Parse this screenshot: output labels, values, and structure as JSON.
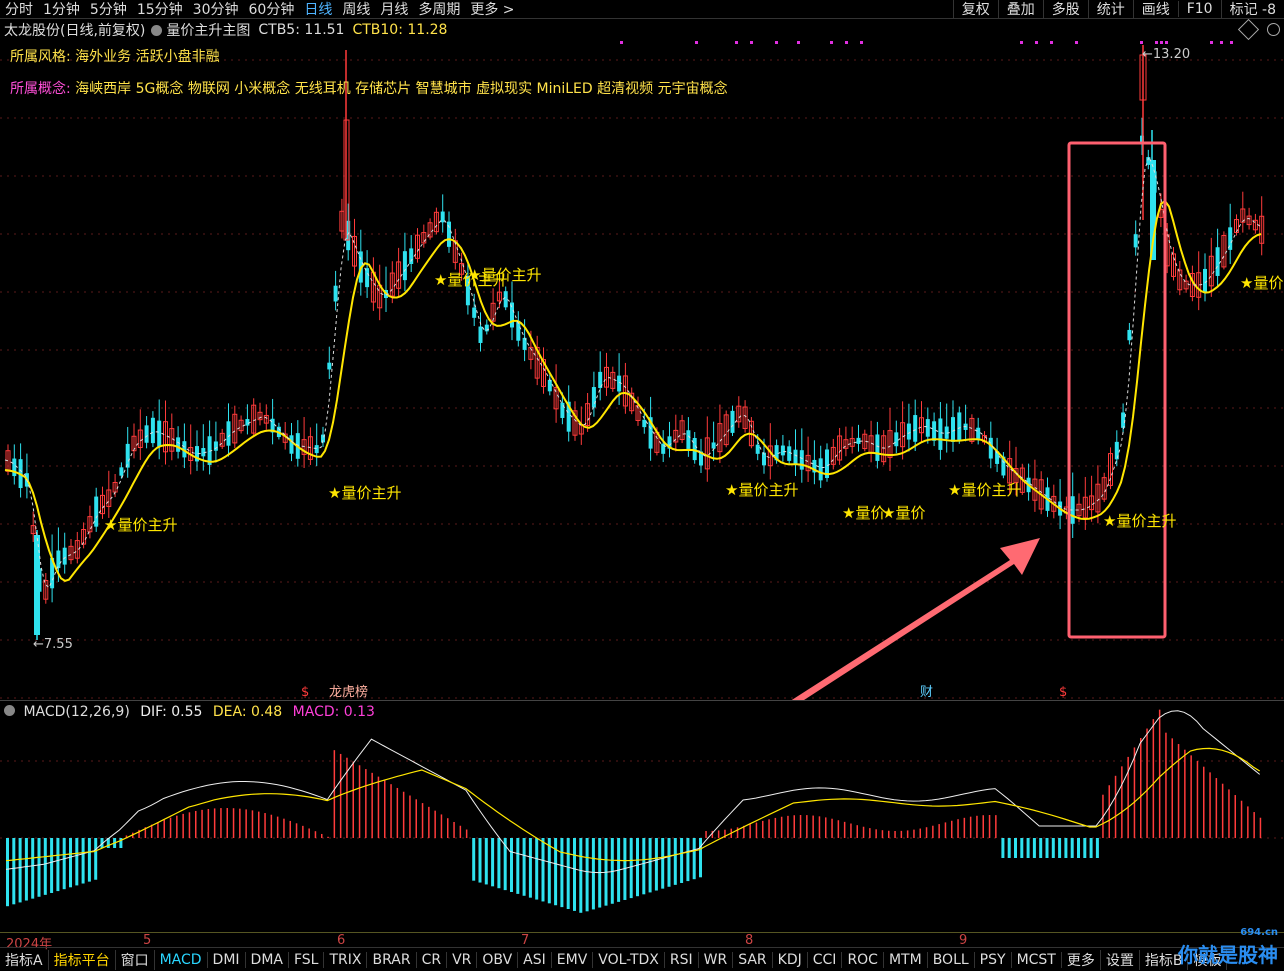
{
  "topbar": {
    "periods": [
      "分时",
      "1分钟",
      "5分钟",
      "15分钟",
      "30分钟",
      "60分钟",
      "日线",
      "周线",
      "月线",
      "多周期",
      "更多 >"
    ],
    "active_index": 6,
    "right_items": [
      "复权",
      "叠加",
      "多股",
      "统计",
      "画线",
      "F10",
      "标记 -8"
    ]
  },
  "titlebar": {
    "stock": "太龙股份(日线,前复权)",
    "indicator": "量价主升主图",
    "ctb5": "CTB5: 11.51",
    "ctb10": "CTB10: 11.28"
  },
  "info": {
    "style_label": "所属风格:",
    "style_value": "海外业务 活跃小盘非融",
    "concept_label": "所属概念:",
    "concept_value": "海峡西岸 5G概念 物联网 小米概念 无线耳机 存储芯片 智慧城市 虚拟现实 MiniLED 超清视频 元宇宙概念"
  },
  "markers": {
    "low": "←7.55",
    "high": "←13.20",
    "signal_label": "★量价主升",
    "signal_cut": "★量价",
    "events": [
      "$",
      "龙虎榜",
      "财",
      "$"
    ]
  },
  "macd": {
    "title": "MACD(12,26,9)",
    "dif": "DIF: 0.55",
    "dea": "DEA: 0.48",
    "macd": "MACD: 0.13"
  },
  "dates": [
    "2024年",
    "5",
    "6",
    "7",
    "8",
    "9"
  ],
  "bottombar": {
    "tabs": [
      "指标A",
      "指标平台",
      "窗口",
      "MACD",
      "DMI",
      "DMA",
      "FSL",
      "TRIX",
      "BRAR",
      "CR",
      "VR",
      "OBV",
      "ASI",
      "EMV",
      "VOL-TDX",
      "RSI",
      "WR",
      "SAR",
      "KDJ",
      "CCI",
      "ROC",
      "MTM",
      "BOLL",
      "PSY",
      "MCST",
      "更多",
      "设置",
      "指标B",
      "模板"
    ]
  },
  "watermark": {
    "text": "你就是股神",
    "site": "694.cn"
  },
  "colors": {
    "up": "#ff3b3b",
    "down": "#2fe2ef",
    "ma": "#ffe600",
    "box": "#ff6070"
  }
}
